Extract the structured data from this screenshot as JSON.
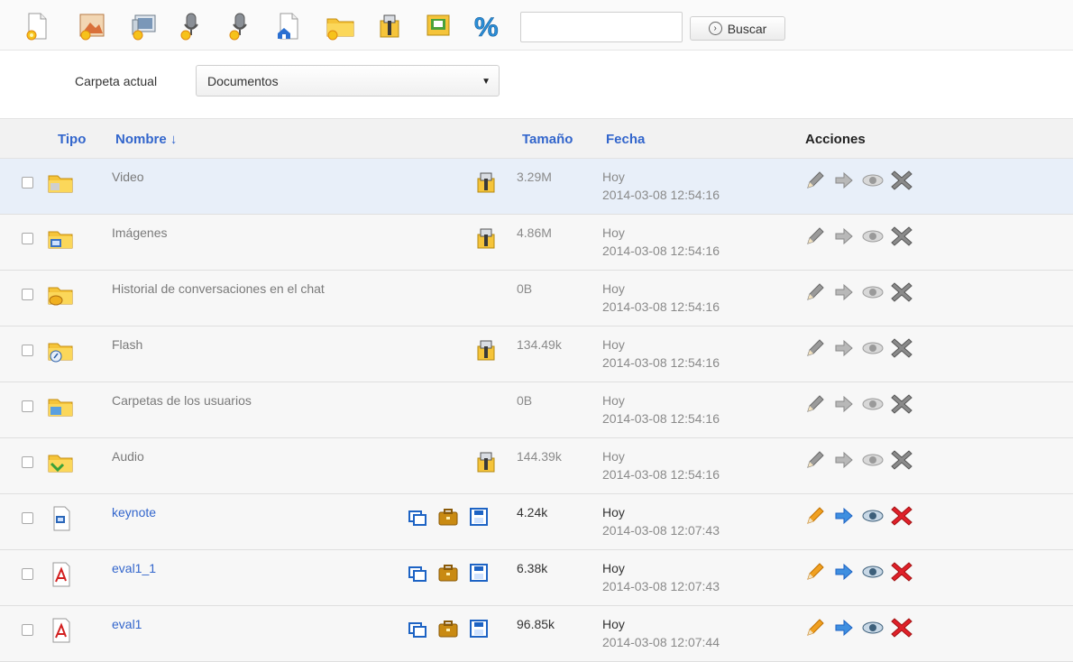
{
  "toolbar": {
    "buttons": [
      {
        "name": "new-file-icon"
      },
      {
        "name": "new-image-icon"
      },
      {
        "name": "new-gallery-icon"
      },
      {
        "name": "record-audio-icon"
      },
      {
        "name": "record-audio-2-icon"
      },
      {
        "name": "home-file-icon"
      },
      {
        "name": "new-folder-icon"
      },
      {
        "name": "zip-icon"
      },
      {
        "name": "slideshow-icon"
      },
      {
        "name": "percent-icon"
      }
    ],
    "search_value": "",
    "search_button": "Buscar"
  },
  "folder": {
    "label": "Carpeta actual",
    "selected": "Documentos"
  },
  "table": {
    "headers": {
      "tipo": "Tipo",
      "nombre": "Nombre ↓",
      "tamano": "Tamaño",
      "fecha": "Fecha",
      "acciones": "Acciones"
    },
    "rows": [
      {
        "name": "Video",
        "size": "3.29M",
        "date": "Hoy",
        "datetime": "2014-03-08 12:54:16",
        "kind": "folder",
        "zip": true
      },
      {
        "name": "Imágenes",
        "size": "4.86M",
        "date": "Hoy",
        "datetime": "2014-03-08 12:54:16",
        "kind": "folder",
        "zip": true
      },
      {
        "name": "Historial de conversaciones en el chat",
        "size": "0B",
        "date": "Hoy",
        "datetime": "2014-03-08 12:54:16",
        "kind": "folder",
        "zip": false
      },
      {
        "name": "Flash",
        "size": "134.49k",
        "date": "Hoy",
        "datetime": "2014-03-08 12:54:16",
        "kind": "folder",
        "zip": true
      },
      {
        "name": "Carpetas de los usuarios",
        "size": "0B",
        "date": "Hoy",
        "datetime": "2014-03-08 12:54:16",
        "kind": "folder",
        "zip": false
      },
      {
        "name": "Audio",
        "size": "144.39k",
        "date": "Hoy",
        "datetime": "2014-03-08 12:54:16",
        "kind": "folder",
        "zip": true
      },
      {
        "name": "keynote",
        "size": "4.24k",
        "date": "Hoy",
        "datetime": "2014-03-08 12:07:43",
        "kind": "file"
      },
      {
        "name": "eval1_1",
        "size": "6.38k",
        "date": "Hoy",
        "datetime": "2014-03-08 12:07:43",
        "kind": "pdf"
      },
      {
        "name": "eval1",
        "size": "96.85k",
        "date": "Hoy",
        "datetime": "2014-03-08 12:07:44",
        "kind": "pdf"
      }
    ]
  },
  "colors": {
    "link": "#3366cc",
    "highlight_row": "#e8eff9",
    "delete_red": "#e0202a",
    "folder_yellow": "#f5c43a",
    "edit_orange": "#f0a020"
  }
}
